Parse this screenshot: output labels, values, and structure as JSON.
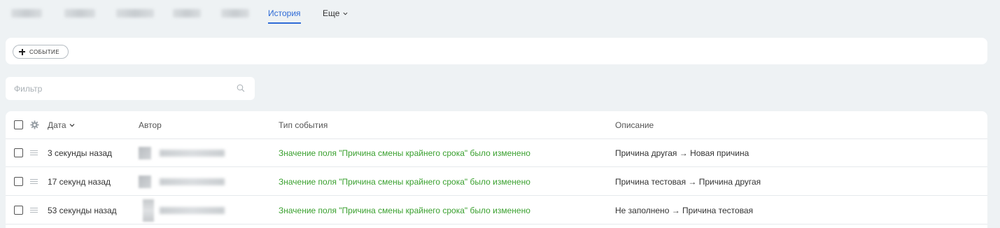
{
  "tabs": {
    "active": "История",
    "more": "Еще"
  },
  "toolbar": {
    "add_event_label": "СОБЫТИЕ"
  },
  "filter": {
    "placeholder": "Фильтр",
    "value": ""
  },
  "table": {
    "columns": {
      "date": "Дата",
      "author": "Автор",
      "event_type": "Тип события",
      "description": "Описание"
    },
    "rows": [
      {
        "date": "3 секунды назад",
        "event_type": "Значение поля \"Причина смены крайнего срока\" было изменено",
        "description": "Причина другая → Новая причина"
      },
      {
        "date": "17 секунд назад",
        "event_type": "Значение поля \"Причина смены крайнего срока\" было изменено",
        "description": "Причина тестовая → Причина другая"
      },
      {
        "date": "53 секунды назад",
        "event_type": "Значение поля \"Причина смены крайнего срока\" было изменено",
        "description": "Не заполнено → Причина тестовая"
      }
    ]
  },
  "colors": {
    "accent": "#2f6bd6",
    "event_type_text": "#3aa02f",
    "background": "#eef2f4"
  },
  "icons": {
    "add": "plus-icon",
    "more_dropdown": "chevron-down-icon",
    "search": "search-icon",
    "settings": "gear-icon",
    "sort": "chevron-down-icon",
    "row_handle": "drag-handle-icon"
  }
}
